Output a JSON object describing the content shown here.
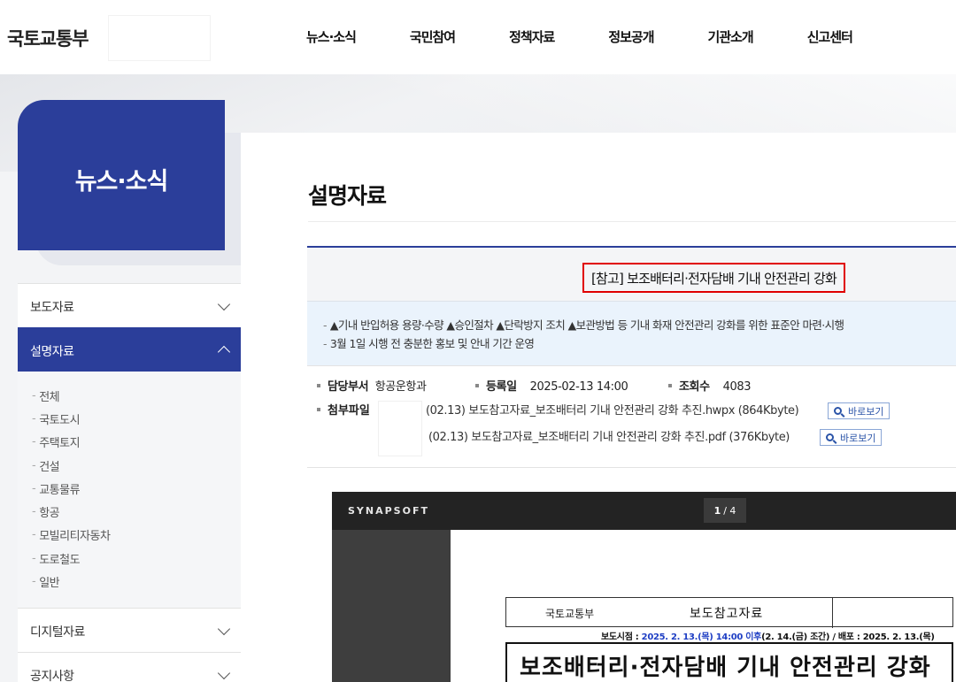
{
  "header": {
    "logo": "국토교통부",
    "nav": [
      "뉴스·소식",
      "국민참여",
      "정책자료",
      "정보공개",
      "기관소개",
      "신고센터"
    ]
  },
  "sidebar": {
    "title": "뉴스·소식",
    "items": [
      {
        "label": "보도자료"
      },
      {
        "label": "설명자료"
      },
      {
        "label": "디지털자료"
      },
      {
        "label": "공지사항"
      }
    ],
    "subitems": [
      "전체",
      "국토도시",
      "주택토지",
      "건설",
      "교통물류",
      "항공",
      "모빌리티자동차",
      "도로철도",
      "일반"
    ]
  },
  "content": {
    "page_title": "설명자료",
    "article": {
      "title": "[참고] 보조배터리·전자담배 기내 안전관리 강화",
      "summary": [
        "▲기내 반입허용 용량·수량 ▲승인절차 ▲단락방지 조치 ▲보관방법 등 기내 화재 안전관리 강화를 위한 표준안 마련·시행",
        "3월 1일 시행 전 충분한 홍보 및 안내 기간 운영"
      ],
      "meta": {
        "dept_label": "담당부서",
        "dept": "항공운항과",
        "date_label": "등록일",
        "date": "2025-02-13 14:00",
        "views_label": "조회수",
        "views": "4083"
      },
      "files_label": "첨부파일",
      "files": [
        {
          "name": "(02.13) 보도참고자료_보조배터리 기내 안전관리 강화 추진.hwpx",
          "size": "(864Kbyte)"
        },
        {
          "name": "(02.13) 보도참고자료_보조배터리 기내 안전관리 강화 추진.pdf",
          "size": "(376Kbyte)"
        }
      ],
      "view_button": "바로보기"
    }
  },
  "viewer": {
    "brand": "SYNAPSOFT",
    "current_page": "1",
    "total_pages": "/ 4",
    "doc": {
      "org": "국토교통부",
      "kind": "보도참고자료",
      "release_prefix": "보도시점 : ",
      "release_time": "2025. 2. 13.(목) 14:00 이후",
      "release_suffix": "(2. 14.(금) 조간) / 배포 : 2025. 2. 13.(목)",
      "title": "보조배터리·전자담배 기내 안전관리 강화"
    }
  },
  "colors": {
    "brand_blue": "#2b3e9a",
    "highlight_red": "#e00000",
    "summary_bg": "#eaf3fc"
  }
}
